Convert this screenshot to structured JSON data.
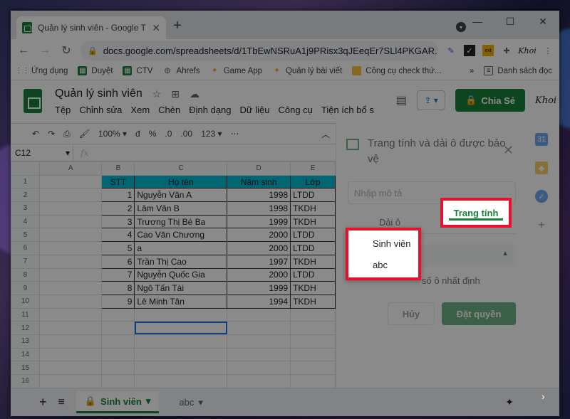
{
  "browser": {
    "tab_title": "Quản lý sinh viên - Google Trang",
    "url": "docs.google.com/spreadsheets/d/1TbEwNSRuA1j9PRisx3qJEeqEr7SLl4PKGAR...",
    "bookmarks": [
      "Ứng dụng",
      "Duyệt",
      "CTV",
      "Ahrefs",
      "Game App",
      "Quản lý bài viết",
      "Công cụ check thứ...",
      "Danh sách đọc"
    ],
    "ext_label": "Khoi"
  },
  "sheets": {
    "doc_title": "Quản lý sinh viên",
    "menus": [
      "Tệp",
      "Chỉnh sửa",
      "Xem",
      "Chèn",
      "Định dạng",
      "Dữ liệu",
      "Công cụ",
      "Tiện ích bổ s"
    ],
    "share_label": "Chia Sẻ",
    "avatar_label": "Khoi",
    "zoom": "100%",
    "format_items": [
      "đ",
      "%",
      ".0",
      ".00",
      "123"
    ],
    "name_box": "C12",
    "fx": "fx"
  },
  "grid": {
    "col_headers": [
      "A",
      "B",
      "C",
      "D",
      "E"
    ],
    "header_row": [
      "STT",
      "Họ tên",
      "Năm sinh",
      "Lớp"
    ],
    "rows": [
      {
        "stt": "1",
        "name": "Nguyễn Văn A",
        "year": "1998",
        "class": "LTDD"
      },
      {
        "stt": "2",
        "name": "Lâm Văn B",
        "year": "1998",
        "class": "TKDH"
      },
      {
        "stt": "3",
        "name": "Trương Thị Bé Ba",
        "year": "1999",
        "class": "TKDH"
      },
      {
        "stt": "4",
        "name": "Cao Văn Chương",
        "year": "2000",
        "class": "LTDD"
      },
      {
        "stt": "5",
        "name": "a",
        "year": "2000",
        "class": "LTDD"
      },
      {
        "stt": "6",
        "name": "Trần Thị Cao",
        "year": "1997",
        "class": "TKDH"
      },
      {
        "stt": "7",
        "name": "Nguyễn Quốc Gia",
        "year": "2000",
        "class": "LTDD"
      },
      {
        "stt": "8",
        "name": "Ngô Tấn Tài",
        "year": "1999",
        "class": "TKDH"
      },
      {
        "stt": "9",
        "name": "Lê Minh Tân",
        "year": "1994",
        "class": "TKDH"
      }
    ],
    "row_numbers": [
      "1",
      "2",
      "3",
      "4",
      "5",
      "6",
      "7",
      "8",
      "9",
      "10",
      "11",
      "12",
      "13",
      "14",
      "15",
      "16"
    ]
  },
  "sheet_tabs": {
    "active": "Sinh viên",
    "other": "abc"
  },
  "panel": {
    "title": "Trang tính và dải ô được bảo vệ",
    "desc_placeholder": "Nhập mô tả",
    "tab_range": "Dải ô",
    "tab_sheet": "Trang tính",
    "except_text": "số ô nhất định",
    "cancel": "Hủy",
    "set_permission": "Đặt quyền",
    "sheet_options": [
      "Sinh viên",
      "abc"
    ]
  },
  "colors": {
    "accent": "#188038",
    "highlight": "#e8112d",
    "header_fill": "#00bcd4"
  }
}
